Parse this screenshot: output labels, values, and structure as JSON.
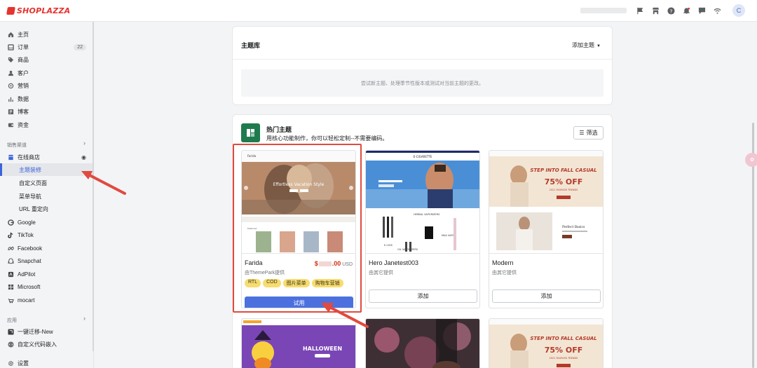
{
  "brand": {
    "name": "SHOPLAZZA",
    "color": "#e5342f"
  },
  "topbar": {
    "icons": [
      "flag-icon",
      "store-icon",
      "help-icon",
      "bell-icon",
      "chat-icon",
      "wifi-icon"
    ],
    "avatar_initial": "C"
  },
  "sidebar": {
    "items": [
      {
        "label": "主页",
        "icon": "home-icon"
      },
      {
        "label": "订单",
        "icon": "orders-icon",
        "badge": "22"
      },
      {
        "label": "商品",
        "icon": "tag-icon"
      },
      {
        "label": "客户",
        "icon": "user-icon"
      },
      {
        "label": "营销",
        "icon": "marketing-icon"
      },
      {
        "label": "数据",
        "icon": "chart-icon"
      },
      {
        "label": "博客",
        "icon": "blog-icon"
      },
      {
        "label": "资金",
        "icon": "wallet-icon"
      }
    ],
    "channels_label": "销售渠道",
    "online_store": "在线商店",
    "sub_items": [
      "主题装修",
      "自定义页面",
      "菜单导航",
      "URL 重定向"
    ],
    "channels": [
      "Google",
      "TikTok",
      "Facebook",
      "Snapchat",
      "AdPilot",
      "Microsoft",
      "mocart"
    ],
    "apps_label": "应用",
    "apps": [
      "一键迁移-New",
      "自定义代码嵌入"
    ],
    "settings": "设置"
  },
  "theme_library": {
    "title": "主题库",
    "add_theme": "添加主题",
    "empty_text": "尝试新主题、处理季节性版本或测试对当前主题的更改。"
  },
  "popular": {
    "title": "热门主题",
    "subtitle": "用核心功能制作，你可以轻松定制--不需要编码。",
    "filter": "筛选",
    "themes": [
      {
        "name": "Farida",
        "by": "由ThemePark提供",
        "price": ".00",
        "currency": "USD",
        "tags": [
          "RTL",
          "COD",
          "图片菜单",
          "购物车营销"
        ],
        "action": "试用"
      },
      {
        "name": "Hero Janetest003",
        "by": "由其它提供",
        "action": "添加"
      },
      {
        "name": "Modern",
        "by": "由其它提供",
        "action": "添加"
      }
    ]
  },
  "previews": {
    "farida_hero": "Effortless Vacation Style",
    "fall_title": "STEP INTO FALL CASUAL",
    "fall_offer": "75% OFF",
    "fall_trends": "2021 FASHION TRENDS",
    "perfect_basics": "Perfect Basics",
    "herbal": "HERBAL VAPORIZERS",
    "eciga": "E-CIGS",
    "max_vapo": "MAX VAPO",
    "oil": "OIL VAPORIZERS",
    "halloween": "HALLOWEEN",
    "ecig_brand": "E-CIGARETTE"
  },
  "colors": {
    "primary": "#4c71de",
    "highlight": "#e14a3f",
    "theme_icon": "#1e7b4d"
  }
}
